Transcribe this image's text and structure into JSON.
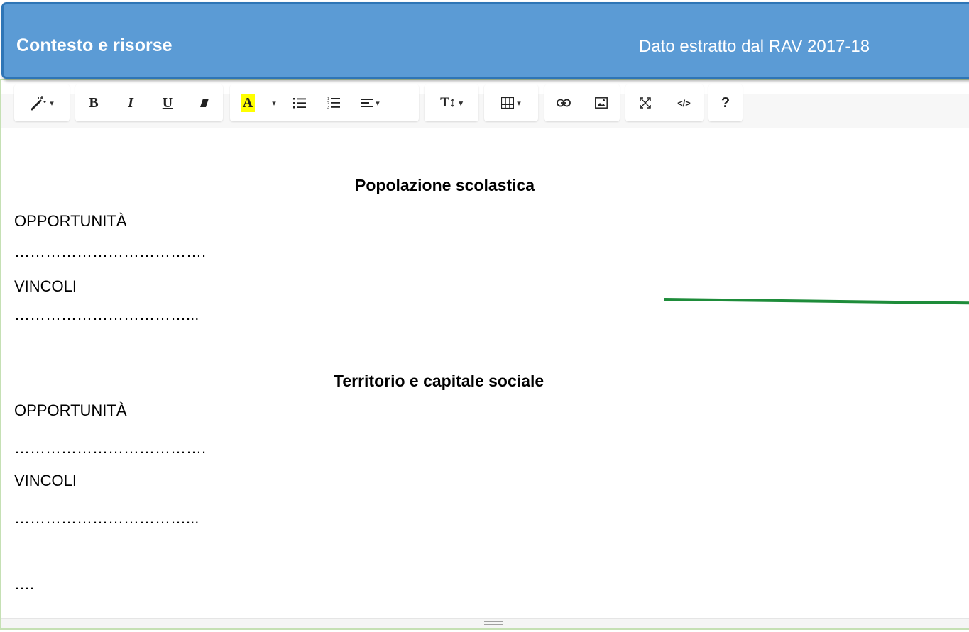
{
  "header": {
    "title": "Contesto e risorse",
    "source": "Dato estratto dal RAV 2017-18",
    "background_color": "#5b9bd5",
    "border_color": "#2e75b6"
  },
  "toolbar": {
    "style_icon": "magic-wand-icon",
    "bold_label": "B",
    "italic_label": "I",
    "underline_label": "U",
    "eraser_icon": "eraser-icon",
    "color_label": "A",
    "color_highlight": "#ffff00",
    "unordered_list_icon": "unordered-list-icon",
    "ordered_list_icon": "ordered-list-icon",
    "align_icon": "align-icon",
    "line_height_label": "T↕",
    "table_icon": "table-icon",
    "link_icon": "link-icon",
    "picture_icon": "picture-icon",
    "fullscreen_icon": "fullscreen-icon",
    "codeview_label": "</>",
    "help_label": "?",
    "caret": "▾"
  },
  "content": {
    "section1": {
      "heading": "Popolazione scolastica",
      "opportunities_label": "OPPORTUNITÀ",
      "opportunities_text": "……………………………….",
      "constraints_label": "VINCOLI",
      "constraints_text": "……………………………..."
    },
    "section2": {
      "heading": "Territorio e capitale sociale",
      "opportunities_label": "OPPORTUNITÀ",
      "opportunities_text": "……………………………….",
      "constraints_label": "VINCOLI",
      "constraints_text": "……………………………..."
    },
    "trailing_text": "…."
  },
  "annotation": {
    "line_color": "#1e8c3a"
  },
  "editor": {
    "border_color": "#c5e0b4"
  }
}
